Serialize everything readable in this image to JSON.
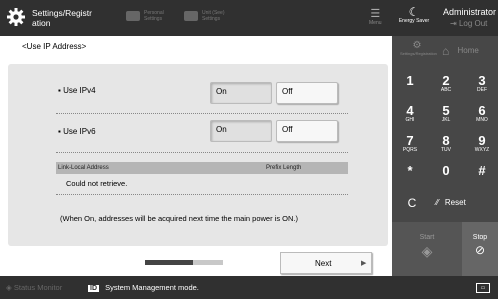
{
  "topbar": {
    "title": "Settings/Registr\nation",
    "tab_personal": "Personal Settings",
    "tab_unit": "Unit (See) Settings",
    "menu": "Menu",
    "energy_saver": "Energy Saver",
    "user": "Administrator",
    "logout": "Log Out"
  },
  "page": {
    "title": "<Use IP Address>",
    "ipv4_label": "Use IPv4",
    "ipv6_label": "Use IPv6",
    "on": "On",
    "off": "Off",
    "col_address": "Link-Local Address",
    "col_prefix": "Prefix Length",
    "not_retrieved": "Could not retrieve.",
    "note": "(When On, addresses will be acquired next time the main power is ON.)",
    "progress_fraction": 0.62,
    "next": "Next"
  },
  "side": {
    "settings_reg": "Settings/Registration",
    "home": "Home",
    "keys": [
      {
        "d": "1",
        "l": ""
      },
      {
        "d": "2",
        "l": "ABC"
      },
      {
        "d": "3",
        "l": "DEF"
      },
      {
        "d": "4",
        "l": "GHI"
      },
      {
        "d": "5",
        "l": "JKL"
      },
      {
        "d": "6",
        "l": "MNO"
      },
      {
        "d": "7",
        "l": "PQRS"
      },
      {
        "d": "8",
        "l": "TUV"
      },
      {
        "d": "9",
        "l": "WXYZ"
      },
      {
        "d": "*",
        "l": ""
      },
      {
        "d": "0",
        "l": ""
      },
      {
        "d": "#",
        "l": ""
      }
    ],
    "clear": "C",
    "reset": "Reset",
    "start": "Start",
    "stop": "Stop"
  },
  "status": {
    "monitor": "Status Monitor",
    "message": "System Management mode."
  }
}
